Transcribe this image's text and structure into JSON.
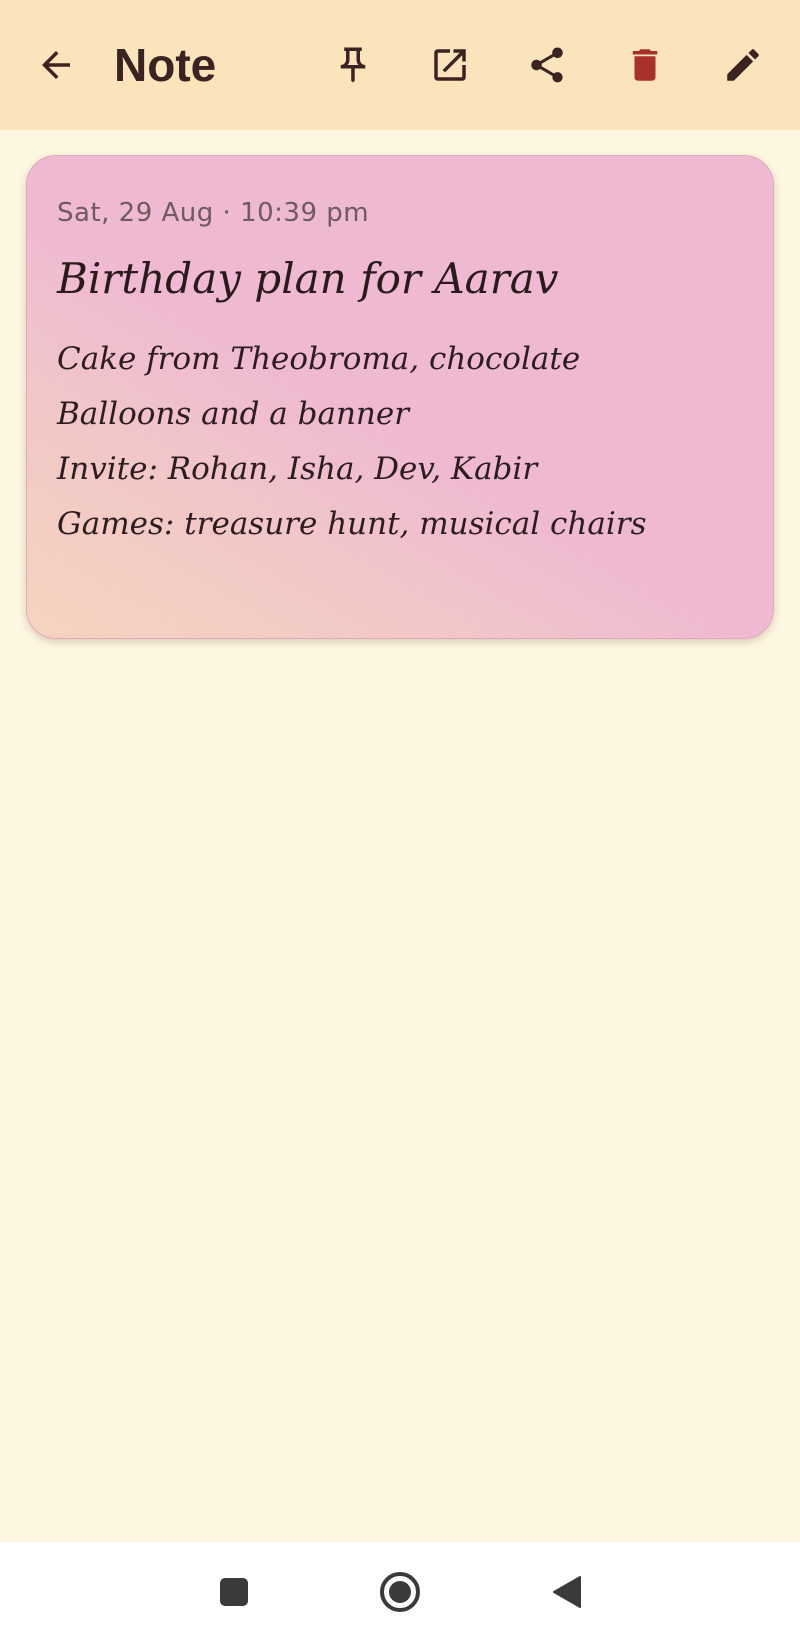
{
  "app_bar": {
    "title": "Note",
    "icons": {
      "back": "arrow-left-icon",
      "pin": "pin-icon",
      "open_external": "open-in-new-icon",
      "share": "share-icon",
      "delete": "trash-icon",
      "edit": "pencil-icon"
    }
  },
  "note": {
    "date": "Sat, 29 Aug · 10:39 pm",
    "title": "Birthday plan for Aarav",
    "lines": [
      "Cake from Theobroma, chocolate",
      "Balloons and a banner",
      "Invite: Rohan, Isha, Dev, Kabir",
      "Games: treasure hunt, musical chairs"
    ]
  },
  "nav_bar": {
    "icons": {
      "recents": "square-icon",
      "home": "circle-icon",
      "back": "triangle-back-icon"
    }
  },
  "colors": {
    "app_bar_bg": "#fbe3bc",
    "page_bg": "#fdf6e1",
    "card_pink": "#efbad1",
    "card_peach": "#f6d4bf",
    "delete_red": "#a8322b",
    "icon_dark": "#3a2320"
  }
}
